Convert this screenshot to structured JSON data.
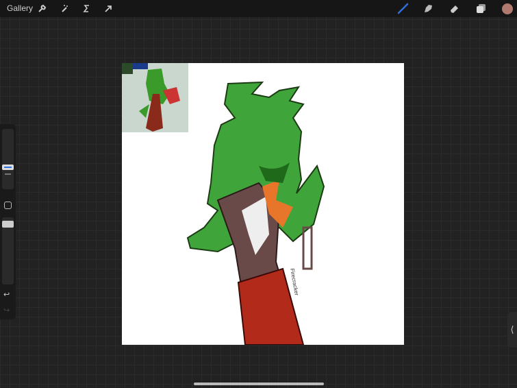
{
  "topbar": {
    "gallery_label": "Gallery",
    "left_tools": [
      "wrench-icon",
      "magic-wand-icon",
      "selection-icon",
      "transform-arrow-icon"
    ],
    "right_tools": [
      "brush-icon",
      "smudge-icon",
      "eraser-icon",
      "layers-icon",
      "color-swatch"
    ],
    "brush_color": "#2f6fe0",
    "current_color": "#b07a6e"
  },
  "sidebar": {
    "brush_size_level": 0.35,
    "opacity_level": 1.0
  },
  "canvas": {
    "signature": "Firecracker"
  },
  "handle": {
    "label": "⟨"
  }
}
